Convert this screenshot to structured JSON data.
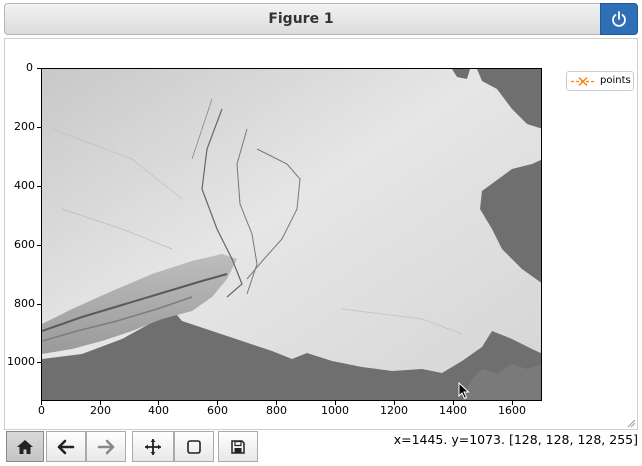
{
  "window": {
    "title": "Figure 1"
  },
  "plot": {
    "y_ticks": [
      "0",
      "200",
      "400",
      "600",
      "800",
      "1000"
    ],
    "x_ticks": [
      "0",
      "200",
      "400",
      "600",
      "800",
      "1000",
      "1200",
      "1400",
      "1600"
    ],
    "legend_label": "points",
    "legend_color": "#ff7f0e"
  },
  "status": {
    "coords": "x=1445. y=1073. [128, 128, 128, 255]"
  },
  "toolbar": {
    "buttons": [
      "home-icon",
      "back-arrow-icon",
      "forward-arrow-icon",
      "pan-arrows-icon",
      "zoom-rect-icon",
      "save-icon"
    ]
  },
  "colors": {
    "accent": "#2f6fb6",
    "land": "#6f6f6f",
    "ice": "#d9d9d9"
  }
}
